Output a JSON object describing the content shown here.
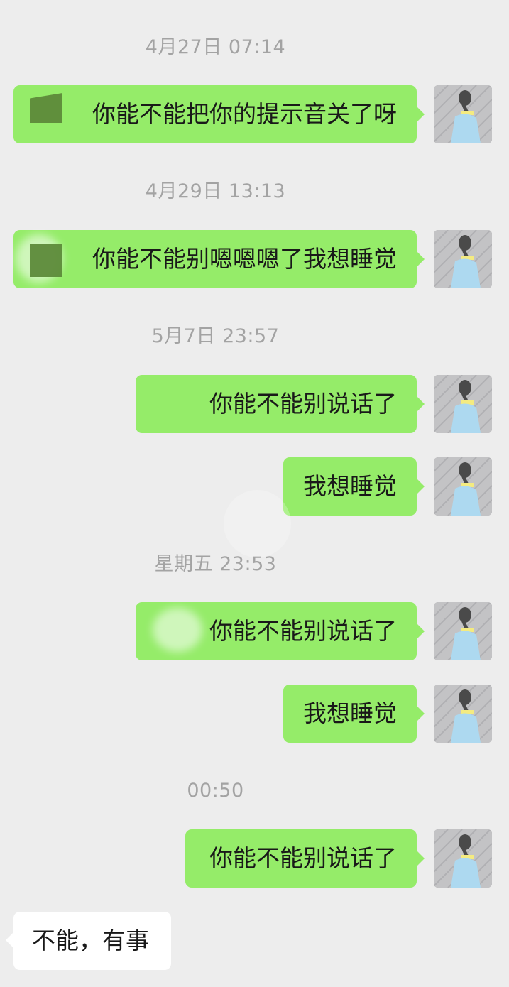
{
  "messages": [
    {
      "kind": "timestamp",
      "text": "4月27日 07:14"
    },
    {
      "kind": "sent",
      "text": "你能不能把你的提示音关了呀"
    },
    {
      "kind": "timestamp",
      "text": "4月29日 13:13"
    },
    {
      "kind": "sent",
      "text": "你能不能别嗯嗯嗯了我想睡觉"
    },
    {
      "kind": "timestamp",
      "text": "5月7日 23:57"
    },
    {
      "kind": "sent",
      "text": "你能不能别说话了"
    },
    {
      "kind": "sent",
      "text": "我想睡觉"
    },
    {
      "kind": "timestamp",
      "text": "星期五 23:53"
    },
    {
      "kind": "sent",
      "text": "你能不能别说话了"
    },
    {
      "kind": "sent",
      "text": "我想睡觉"
    },
    {
      "kind": "timestamp",
      "text": "00:50"
    },
    {
      "kind": "sent",
      "text": "你能不能别说话了"
    },
    {
      "kind": "received",
      "text": "不能，有事"
    }
  ],
  "colors": {
    "background": "#ededed",
    "sent_bubble": "#95ec69",
    "received_bubble": "#ffffff",
    "timestamp_text": "#a3a3a3",
    "message_text": "#191919"
  },
  "icons": {
    "avatar": "user-avatar-photo"
  }
}
